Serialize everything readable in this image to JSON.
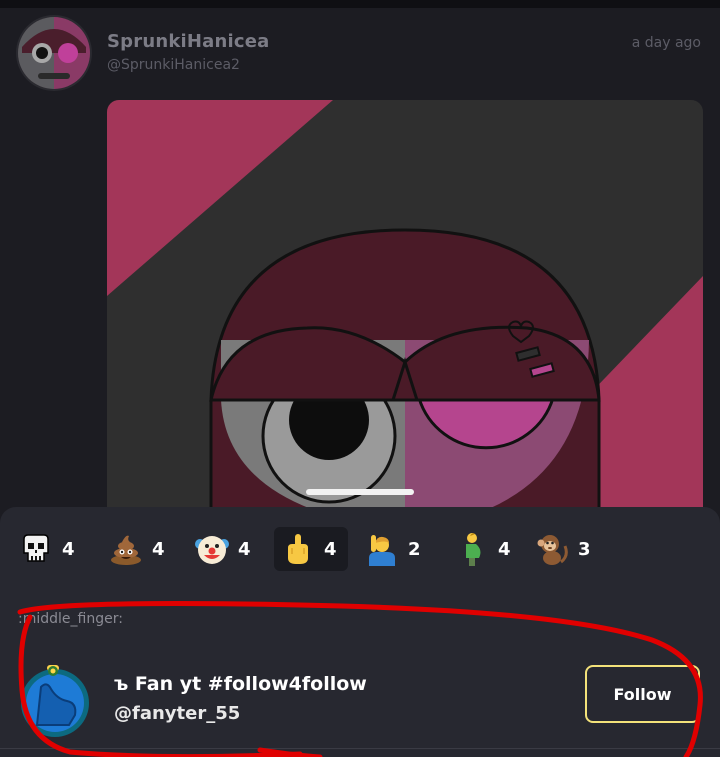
{
  "post": {
    "username": "SprunkiHanicea",
    "handle": "@SprunkiHanicea2",
    "timestamp": "a day ago"
  },
  "reactions": [
    {
      "icon": "skull-icon",
      "count": "4",
      "active": false
    },
    {
      "icon": "poop-icon",
      "count": "4",
      "active": false
    },
    {
      "icon": "clown-face-icon",
      "count": "4",
      "active": false
    },
    {
      "icon": "middle-finger-icon",
      "count": "4",
      "active": true
    },
    {
      "icon": "raising-hand-person-icon",
      "count": "2",
      "active": false
    },
    {
      "icon": "pregnant-man-icon",
      "count": "4",
      "active": false
    },
    {
      "icon": "monkey-icon",
      "count": "3",
      "active": false
    }
  ],
  "selected_reaction_label": ":middle_finger:",
  "reactor": {
    "name": "ъ Fan yt #follow4follow",
    "handle": "@fanyter_55",
    "follow_label": "Follow"
  },
  "colors": {
    "background": "#1c1c22",
    "sheet": "#272830",
    "follow_border": "#f3e27a",
    "annotation": "#e00000"
  }
}
